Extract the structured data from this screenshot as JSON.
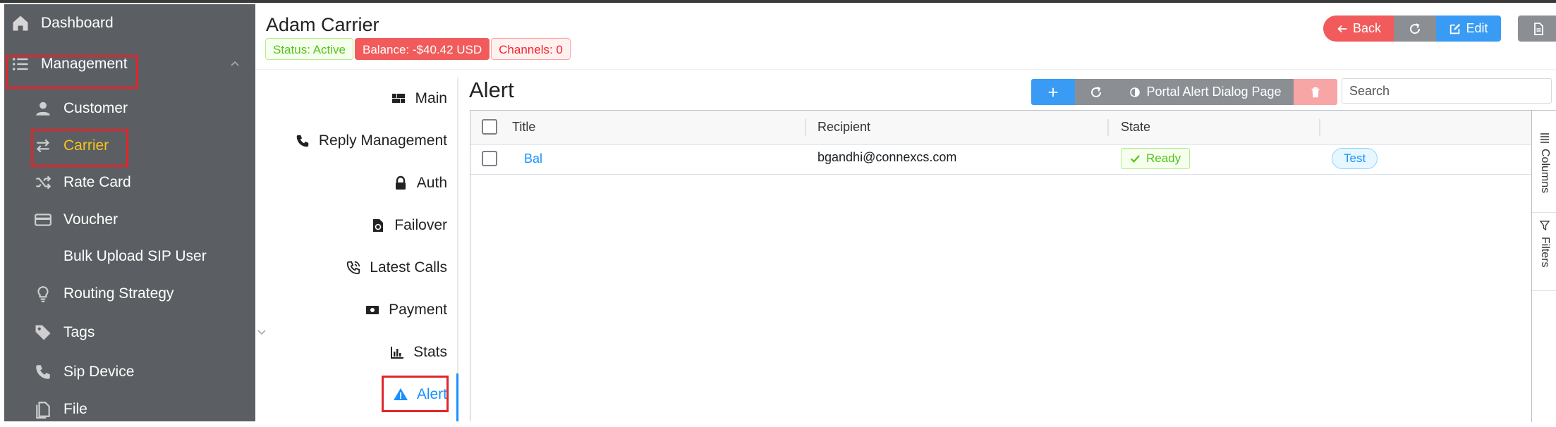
{
  "sidebar": {
    "items": [
      {
        "label": "Dashboard",
        "icon": "home-icon"
      },
      {
        "label": "Management",
        "icon": "list-icon"
      },
      {
        "label": "Customer",
        "icon": "user-icon"
      },
      {
        "label": "Carrier",
        "icon": "swap-icon"
      },
      {
        "label": "Rate Card",
        "icon": "shuffle-icon"
      },
      {
        "label": "Voucher",
        "icon": "credit-card-icon"
      },
      {
        "label": "Bulk Upload SIP User",
        "icon": ""
      },
      {
        "label": "Routing Strategy",
        "icon": "bulb-icon"
      },
      {
        "label": "Tags",
        "icon": "tag-icon"
      },
      {
        "label": "Sip Device",
        "icon": "phone-icon"
      },
      {
        "label": "File",
        "icon": "file-icon"
      }
    ]
  },
  "header": {
    "title": "Adam Carrier",
    "status": "Status: Active",
    "balance": "Balance: -$40.42 USD",
    "channels": "Channels: 0",
    "back_label": "Back",
    "edit_label": "Edit"
  },
  "tabs": [
    {
      "label": "Main",
      "icon": "grid-icon"
    },
    {
      "label": "Reply Management",
      "icon": "phone-icon"
    },
    {
      "label": "Auth",
      "icon": "lock-icon"
    },
    {
      "label": "Failover",
      "icon": "file-sync-icon"
    },
    {
      "label": "Latest Calls",
      "icon": "phone-calls-icon"
    },
    {
      "label": "Payment",
      "icon": "money-icon"
    },
    {
      "label": "Stats",
      "icon": "bar-chart-icon"
    },
    {
      "label": "Alert",
      "icon": "warning-icon"
    }
  ],
  "content": {
    "title": "Alert",
    "toolbar": {
      "portal_label": "Portal Alert Dialog Page"
    },
    "search_placeholder": "Search",
    "columns": [
      "Title",
      "Recipient",
      "State"
    ],
    "rows": [
      {
        "title": "Bal",
        "recipient": "bgandhi@connexcs.com",
        "state": "Ready",
        "action": "Test"
      }
    ],
    "side_panel": {
      "columns_label": "Columns",
      "filters_label": "Filters"
    }
  },
  "colors": {
    "sidebar_bg": "#5b5f63",
    "accent": "#1890ff",
    "danger": "#f15b5b",
    "active_menu": "#f7c21a"
  }
}
